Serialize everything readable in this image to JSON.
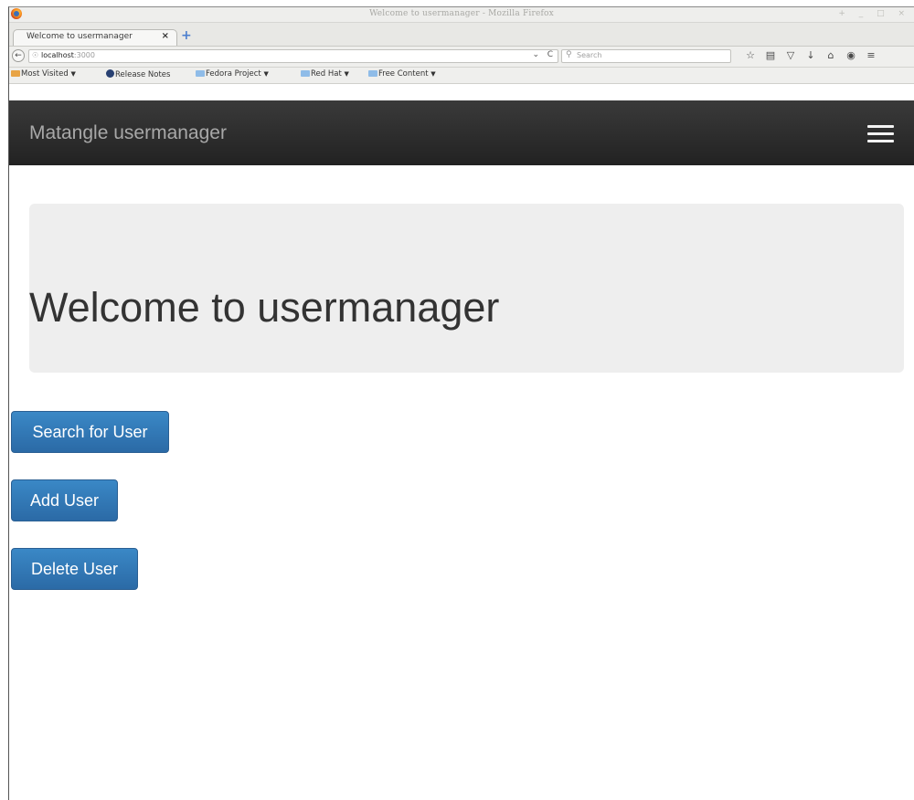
{
  "window": {
    "title": "Welcome to usermanager - Mozilla Firefox",
    "controls": "+ _ □ ×"
  },
  "tab": {
    "label": "Welcome to usermanager",
    "close": "×",
    "new_tab": "+"
  },
  "urlbar": {
    "host": "localhost",
    "port": ":3000",
    "dropdown": "⌄",
    "reload": "C"
  },
  "searchbar": {
    "placeholder": "Search"
  },
  "bookmarks": [
    {
      "label": "Most Visited",
      "icon": "folder-icon"
    },
    {
      "label": "Release Notes",
      "icon": "fedora-icon"
    },
    {
      "label": "Fedora Project",
      "icon": "folder-icon"
    },
    {
      "label": "Red Hat",
      "icon": "folder-icon"
    },
    {
      "label": "Free Content",
      "icon": "folder-icon"
    }
  ],
  "app": {
    "brand": "Matangle usermanager",
    "heading": "Welcome to usermanager",
    "buttons": {
      "search": "Search for User",
      "add": "Add User",
      "delete": "Delete User"
    },
    "colors": {
      "navbar": "#222222",
      "jumbotron": "#eeeeee",
      "button": "#337ab7"
    }
  }
}
